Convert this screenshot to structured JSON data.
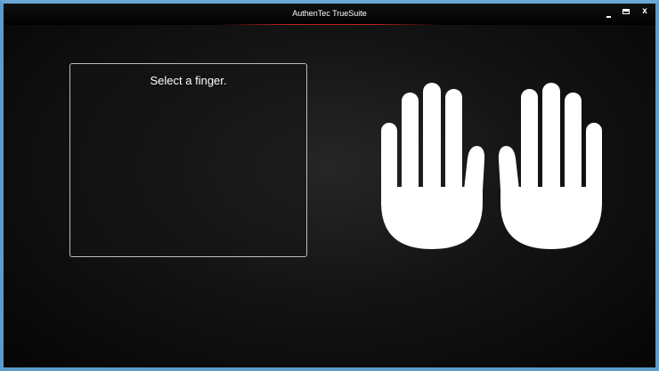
{
  "window": {
    "title": "AuthenTec TrueSuite",
    "minimize_icon": "minimize-icon",
    "maximize_icon": "maximize-icon",
    "close_label": "x"
  },
  "panel": {
    "prompt": "Select a finger."
  },
  "hands": {
    "left": "left-hand-icon",
    "right": "right-hand-icon",
    "fill": "#ffffff"
  },
  "colors": {
    "frame": "#5d9bc8",
    "background": "#101010",
    "accent": "#c42020"
  }
}
